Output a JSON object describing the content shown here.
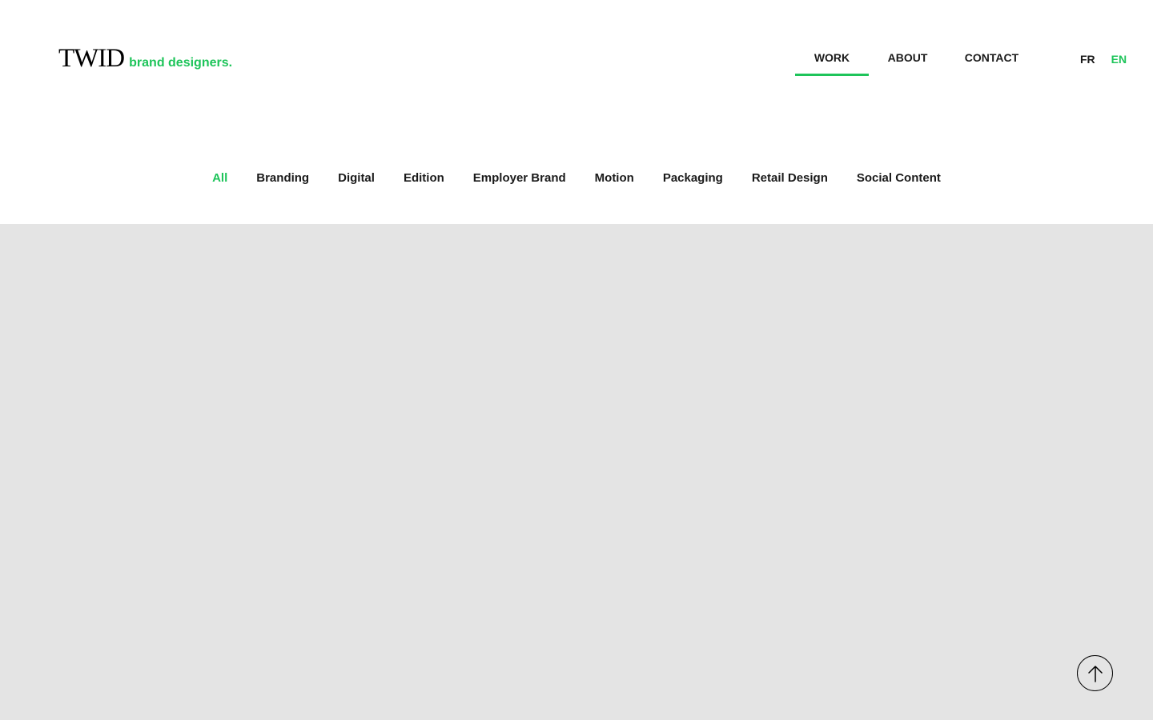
{
  "logo": {
    "mark": "TWID",
    "tagline": "brand designers."
  },
  "nav": {
    "items": [
      {
        "label": "WORK",
        "active": true
      },
      {
        "label": "ABOUT",
        "active": false
      },
      {
        "label": "CONTACT",
        "active": false
      }
    ]
  },
  "languages": [
    {
      "label": "FR",
      "active": false
    },
    {
      "label": "EN",
      "active": true
    }
  ],
  "filters": [
    {
      "label": "All",
      "active": true
    },
    {
      "label": "Branding",
      "active": false
    },
    {
      "label": "Digital",
      "active": false
    },
    {
      "label": "Edition",
      "active": false
    },
    {
      "label": "Employer Brand",
      "active": false
    },
    {
      "label": "Motion",
      "active": false
    },
    {
      "label": "Packaging",
      "active": false
    },
    {
      "label": "Retail Design",
      "active": false
    },
    {
      "label": "Social Content",
      "active": false
    }
  ],
  "icons": {
    "back_to_top": "arrow-up-icon"
  },
  "colors": {
    "accent": "#1ec45a",
    "text": "#1a1a1a",
    "content_background": "#e4e4e4"
  }
}
